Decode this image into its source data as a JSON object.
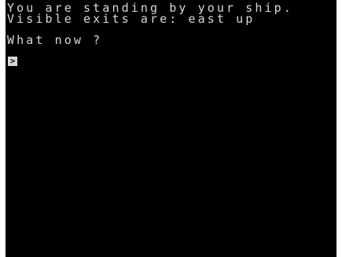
{
  "game": {
    "lines": [
      "You are standing by your ship.",
      "Visible exits are: east up",
      "What now ?"
    ],
    "prompt": ">"
  },
  "colors": {
    "screen_background": "#000000",
    "text": "#d8d8d8",
    "page_background": "#ffffff"
  }
}
